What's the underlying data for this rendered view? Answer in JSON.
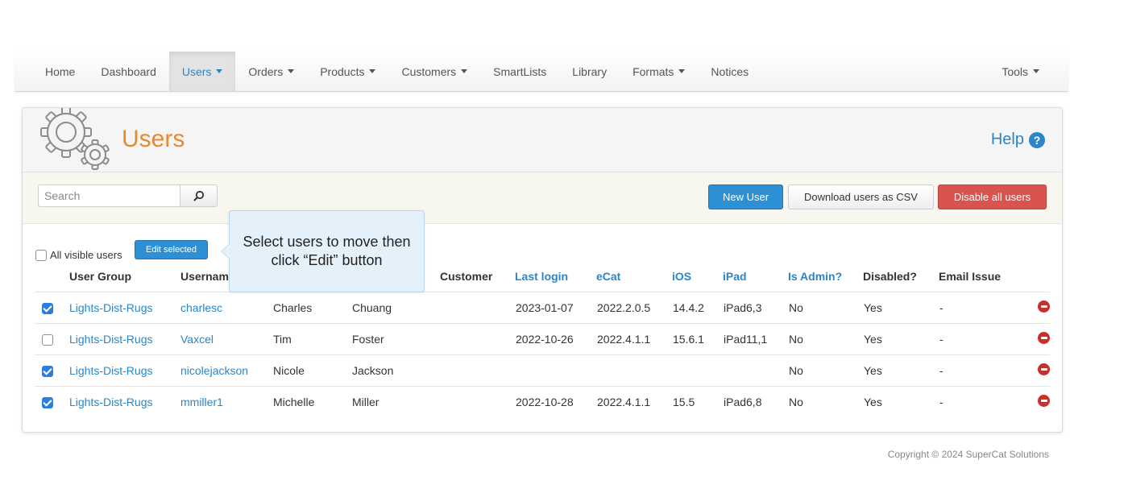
{
  "nav": {
    "items": [
      {
        "label": "Home",
        "dropdown": false
      },
      {
        "label": "Dashboard",
        "dropdown": false
      },
      {
        "label": "Users",
        "dropdown": true,
        "active": true
      },
      {
        "label": "Orders",
        "dropdown": true
      },
      {
        "label": "Products",
        "dropdown": true
      },
      {
        "label": "Customers",
        "dropdown": true
      },
      {
        "label": "SmartLists",
        "dropdown": false
      },
      {
        "label": "Library",
        "dropdown": false
      },
      {
        "label": "Formats",
        "dropdown": true
      },
      {
        "label": "Notices",
        "dropdown": false
      }
    ],
    "tools_label": "Tools"
  },
  "header": {
    "title": "Users",
    "help_label": "Help",
    "help_icon": "?"
  },
  "toolbar": {
    "search_placeholder": "Search",
    "new_user": "New User",
    "download_csv": "Download users as CSV",
    "disable_all": "Disable all users"
  },
  "selection": {
    "all_visible_label": "All visible users",
    "edit_selected": "Edit selected"
  },
  "callout": {
    "text": "Select users to move then click “Edit” button"
  },
  "table": {
    "columns": {
      "user_group": "User Group",
      "username": "Usernam",
      "customer": "Customer",
      "last_login": "Last login",
      "ecat": "eCat",
      "ios": "iOS",
      "ipad": "iPad",
      "is_admin": "Is Admin?",
      "disabled": "Disabled?",
      "email_issue": "Email Issue"
    },
    "rows": [
      {
        "checked": true,
        "user_group": "Lights-Dist-Rugs",
        "username": "charlesc",
        "first": "Charles",
        "last": "Chuang",
        "customer": "",
        "last_login": "2023-01-07",
        "ecat": "2022.2.0.5",
        "ios": "14.4.2",
        "ipad": "iPad6,3",
        "is_admin": "No",
        "disabled": "Yes",
        "email_issue": "-"
      },
      {
        "checked": false,
        "user_group": "Lights-Dist-Rugs",
        "username": "Vaxcel",
        "first": "Tim",
        "last": "Foster",
        "customer": "",
        "last_login": "2022-10-26",
        "ecat": "2022.4.1.1",
        "ios": "15.6.1",
        "ipad": "iPad11,1",
        "is_admin": "No",
        "disabled": "Yes",
        "email_issue": "-"
      },
      {
        "checked": true,
        "user_group": "Lights-Dist-Rugs",
        "username": "nicolejackson",
        "first": "Nicole",
        "last": "Jackson",
        "customer": "",
        "last_login": "",
        "ecat": "",
        "ios": "",
        "ipad": "",
        "is_admin": "No",
        "disabled": "Yes",
        "email_issue": "-"
      },
      {
        "checked": true,
        "user_group": "Lights-Dist-Rugs",
        "username": "mmiller1",
        "first": "Michelle",
        "last": "Miller",
        "customer": "",
        "last_login": "2022-10-28",
        "ecat": "2022.4.1.1",
        "ios": "15.5",
        "ipad": "iPad6,8",
        "is_admin": "No",
        "disabled": "Yes",
        "email_issue": "-"
      }
    ]
  },
  "footer": {
    "copyright": "Copyright © 2024 SuperCat Solutions"
  },
  "colors": {
    "accent_blue": "#2a86c9",
    "title_orange": "#e8892b",
    "danger_red": "#d9534f"
  }
}
